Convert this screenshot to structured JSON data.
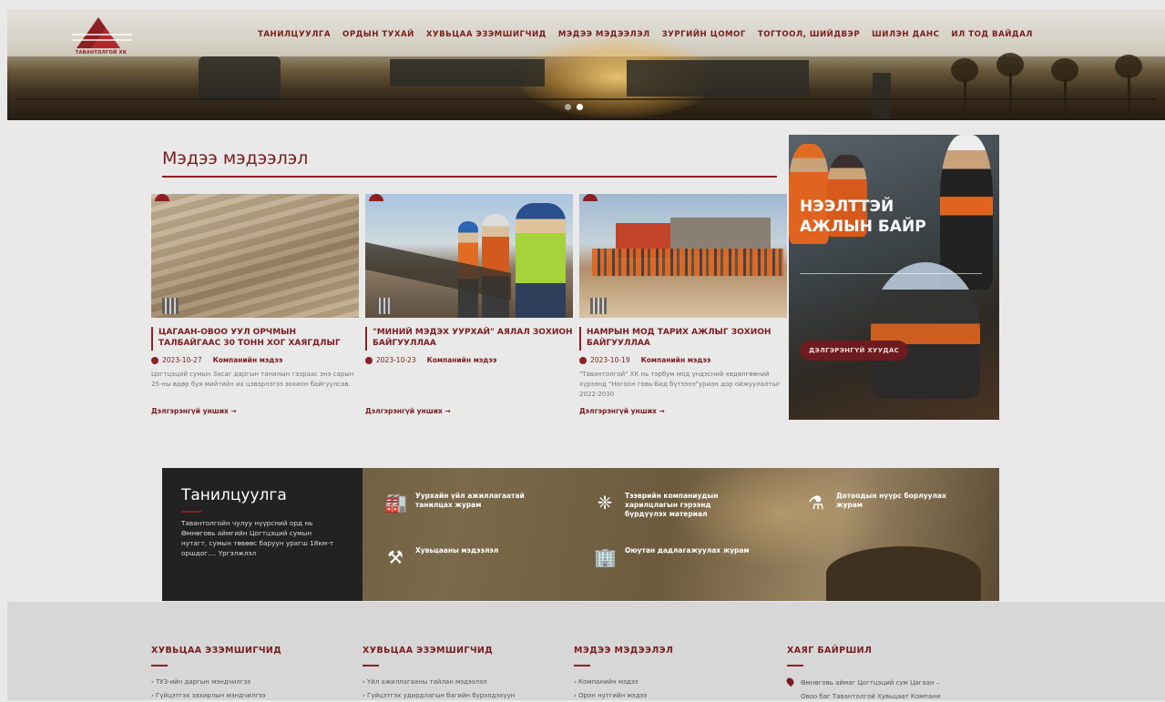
{
  "header": {
    "logo_text": "ТАВАНТОЛГОЙ ХК",
    "nav": [
      "ТАНИЛЦУУЛГА",
      "ОРДЫН ТУХАЙ",
      "ХУВЬЦАА ЭЗЭМШИГЧИД",
      "МЭДЭЭ МЭДЭЭЛЭЛ",
      "ЗУРГИЙН ЦОМОГ",
      "ТОГТООЛ, ШИЙДВЭР",
      "ШИЛЭН ДАНС",
      "ИЛ ТОД ВАЙДАЛ"
    ]
  },
  "news": {
    "title": "Мэдээ мэдээлэл",
    "read_more": "Дэлгэрэнгүй унших →",
    "cards": [
      {
        "title": "ЦАГААН-ОВОО УУЛ ОРЧМЫН ТАЛБАЙГААС 30 ТОНН ХОГ ХАЯГДЛЫГ",
        "date": "2023-10-27",
        "category": "Компанийн мэдээ",
        "desc": "Цогтцэций сумын Засаг даргын танилын газраас энэ сарын 25-ны өдөр буя мийтийн их цэвэрлэгээ зохион байгуулсав."
      },
      {
        "title": "\"МИНИЙ МЭДЭХ УУРХАЙ\" АЯЛАЛ ЗОХИОН БАЙГУУЛЛАА",
        "date": "2023-10-23",
        "category": "Компанийн мэдээ",
        "desc": ""
      },
      {
        "title": "НАМРЫН МОД ТАРИХ АЖЛЫГ ЗОХИОН БАЙГУУЛЛАА",
        "date": "2023-10-19",
        "category": "Компанийн мэдээ",
        "desc": "\"Тавантолгой\" ХК нь тэрбум мод үндэсний хөдөлгөөний хүрээнд \"Ногоон говь-Бид бүтээнэ\"уриан дор ойжуулалтыг 2022-2030"
      }
    ]
  },
  "vacancy": {
    "title_line1": "НЭЭЛТТЭЙ",
    "title_line2": "АЖЛЫН БАЙР",
    "button": "ДЭЛГЭРЭНГҮЙ ХУУДАС"
  },
  "intro": {
    "title": "Танилцуулга",
    "text": "Тавантолгойн чулуу нүүрсний орд нь Өмнөговь аймгийн Цогтцэций сумын нутагт, сумын төвөөс баруун урагш 18км-т оршдог.... Үргэлжлэл",
    "items": [
      {
        "icon": "factory-icon",
        "label": "Уурхайн үйл ажиллагаатай танилцах журам"
      },
      {
        "icon": "gear-icon",
        "label": "Тээврийн компаниудын харилцлагын гэрээнд бүрдүүлэх материал"
      },
      {
        "icon": "flask-icon",
        "label": "Дотоодын нүүрс борлуулах журам"
      },
      {
        "icon": "pickaxe-icon",
        "label": "Хувьцааны мэдээлэл"
      },
      {
        "icon": "building-icon",
        "label": "Оюутан дадлагажуулах журам"
      }
    ]
  },
  "footer": {
    "columns": [
      {
        "title": "ХУВЬЦАА ЭЗЭМШИГЧИД",
        "items": [
          "ТУЗ-ийн даргын мэндчилгээ",
          "Гүйцэтгэх захирлын мэндчилгээ"
        ]
      },
      {
        "title": "ХУВЬЦАА ЭЗЭМШИГЧИД",
        "items": [
          "Үйл ажиллагааны тайлан мэдээлэл",
          "Гүйцэтгэх удирдлагын багийн бүрэлдэхүүн"
        ]
      },
      {
        "title": "МЭДЭЭ МЭДЭЭЛЭЛ",
        "items": [
          "Компанийн мэдээ",
          "Орон нутгийн мэдээ"
        ]
      },
      {
        "title": "ХАЯГ БАЙРШИЛ",
        "items": [
          "Өмнөговь аймаг Цогтцэций сум Цагаан –",
          "Овоо баг Тавантолгой Хувьцаат Компани"
        ]
      }
    ]
  }
}
